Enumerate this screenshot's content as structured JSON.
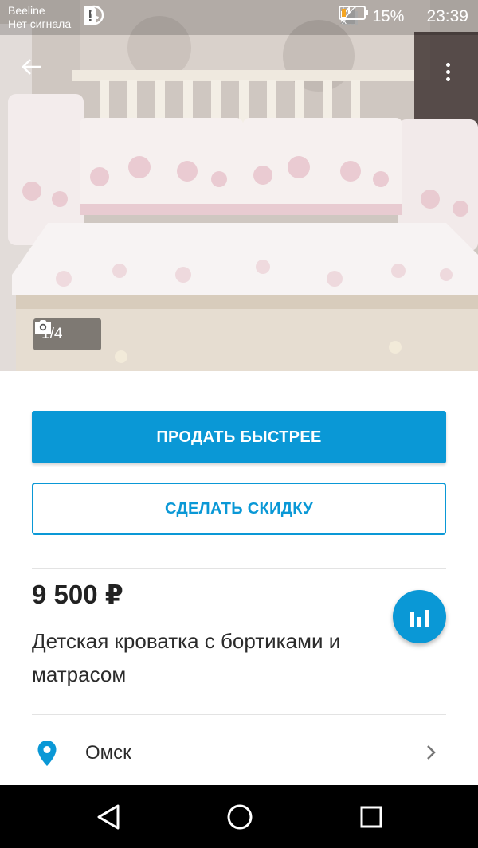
{
  "status_bar": {
    "carrier": "Beeline",
    "signal_status": "Нет сигнала",
    "battery_percent": "15%",
    "time": "23:39",
    "network_type": "H"
  },
  "photo": {
    "counter": "1/4",
    "camera_icon": "camera-icon"
  },
  "actions": {
    "sell_faster_label": "ПРОДАТЬ БЫСТРЕЕ",
    "discount_label": "СДЕЛАТЬ СКИДКУ"
  },
  "listing": {
    "price": "9 500 ₽",
    "title": "Детская кроватка с бортиками и матрасом"
  },
  "location": {
    "city": "Омск"
  },
  "colors": {
    "accent": "#0a98d6",
    "nav_bar": "#000000"
  }
}
